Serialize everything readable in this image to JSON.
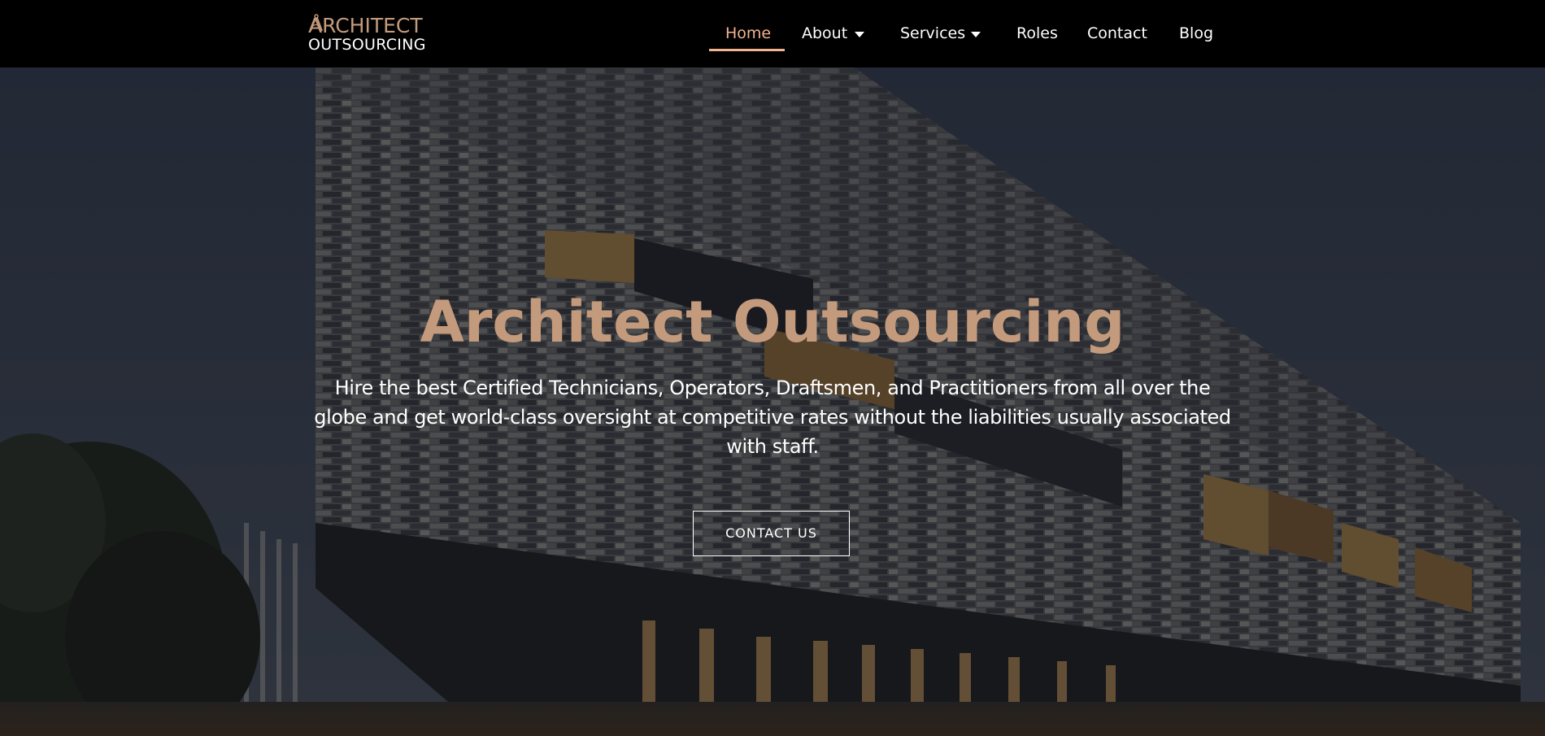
{
  "brand": {
    "line1": "ARCHITECT",
    "line2": "OUTSOURCING",
    "accent_color": "#c39a7c"
  },
  "nav": {
    "items": [
      {
        "label": "Home",
        "active": true
      },
      {
        "label": "About",
        "has_dropdown": true
      },
      {
        "label": "Services",
        "has_dropdown": true
      },
      {
        "label": "Roles"
      },
      {
        "label": "Contact"
      },
      {
        "label": "Blog"
      }
    ],
    "active_color": "#f2b48e"
  },
  "hero": {
    "title": "Architect Outsourcing",
    "subtitle": "Hire the best Certified Technicians, Operators, Draftsmen, and Practitioners from all over the globe and get world-class oversight at competitive rates without the liabilities usually associated with staff.",
    "cta_label": "CONTACT US"
  }
}
